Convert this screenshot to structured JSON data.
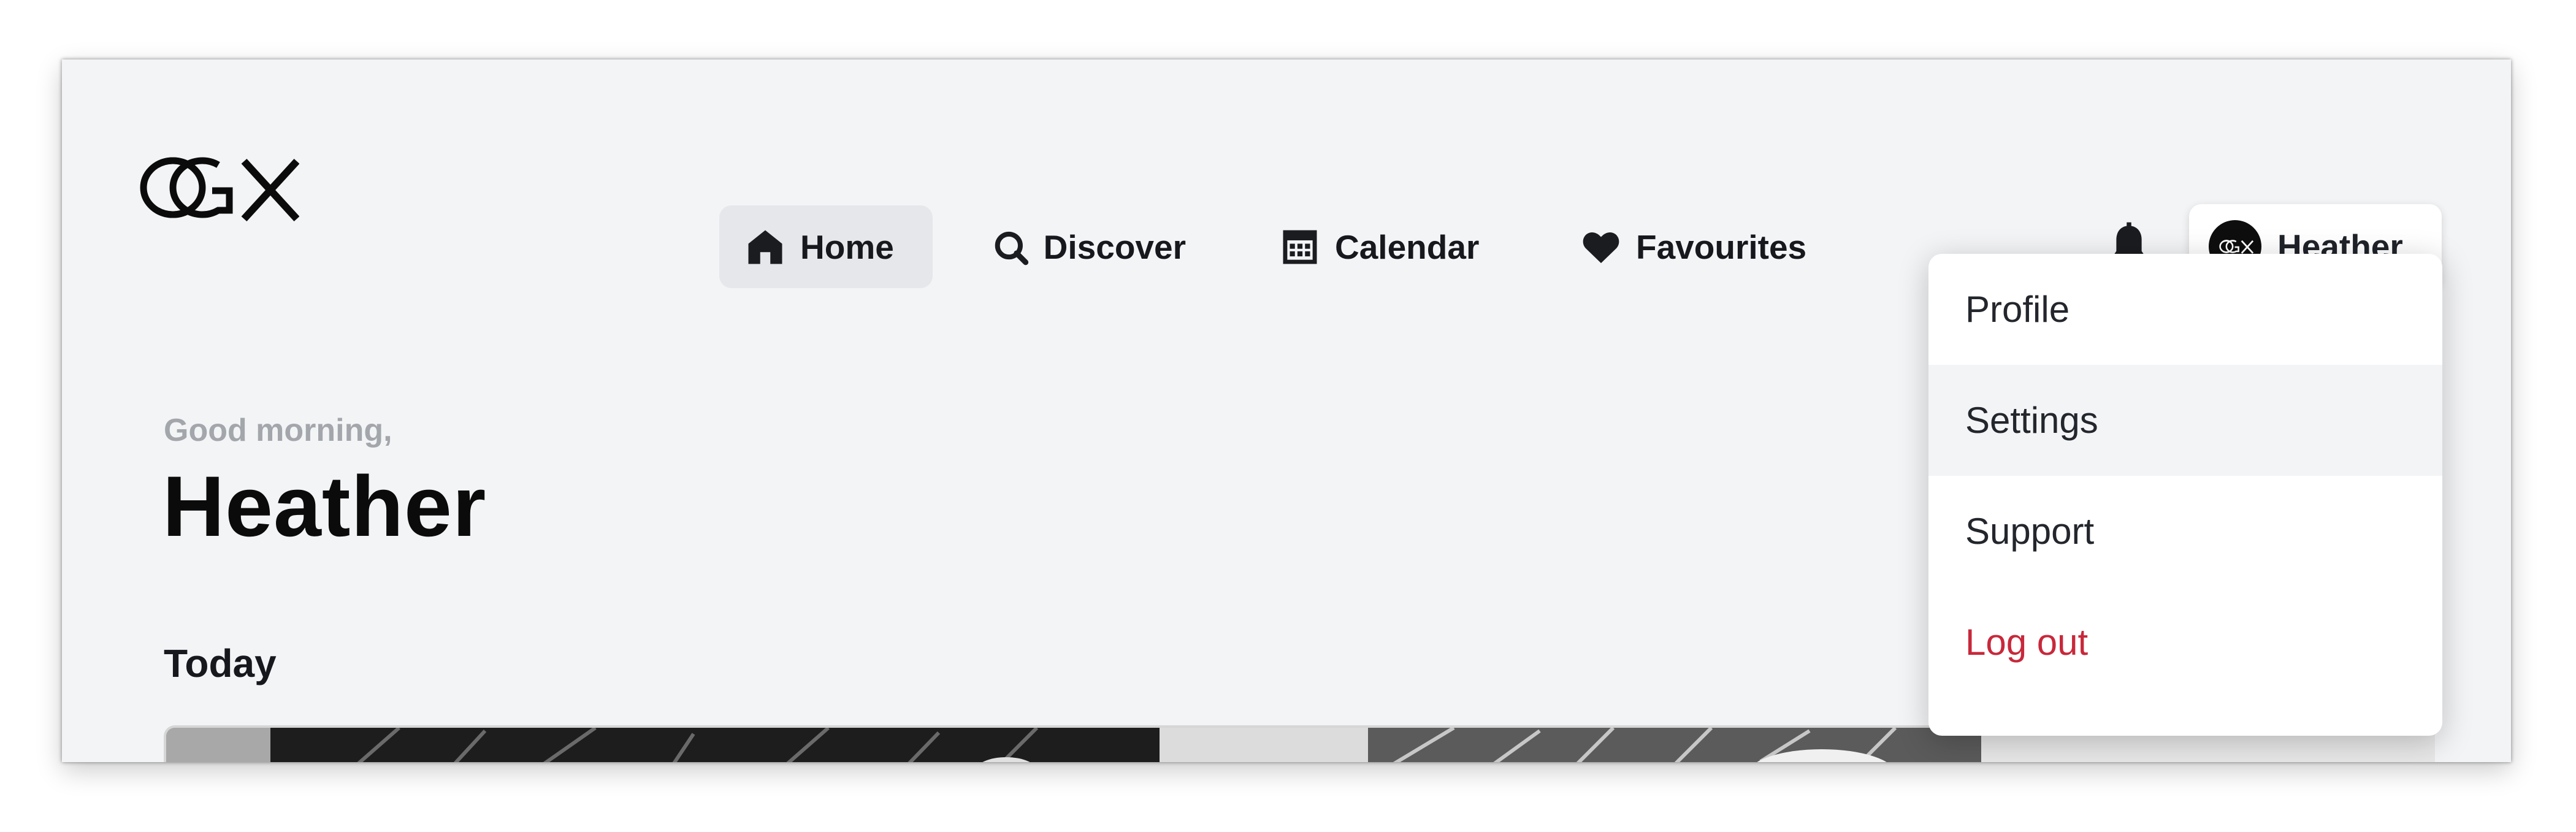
{
  "brand": {
    "logo_text": "OGX"
  },
  "nav": {
    "items": [
      {
        "label": "Home",
        "icon": "home-icon",
        "active": true
      },
      {
        "label": "Discover",
        "icon": "search-icon",
        "active": false
      },
      {
        "label": "Calendar",
        "icon": "calendar-icon",
        "active": false
      },
      {
        "label": "Favourites",
        "icon": "heart-icon",
        "active": false
      }
    ]
  },
  "header": {
    "notifications_icon": "bell-icon",
    "user_name": "Heather"
  },
  "user_menu": {
    "items": [
      {
        "label": "Profile",
        "state": "normal"
      },
      {
        "label": "Settings",
        "state": "hover"
      },
      {
        "label": "Support",
        "state": "normal"
      },
      {
        "label": "Log out",
        "state": "danger"
      }
    ]
  },
  "main": {
    "greeting": "Good morning,",
    "name": "Heather",
    "section_title": "Today"
  },
  "colors": {
    "background": "#f3f4f6",
    "active_nav": "#e6e7ea",
    "danger": "#c8283b",
    "muted_text": "#a3a6ab",
    "text": "#16181d"
  }
}
